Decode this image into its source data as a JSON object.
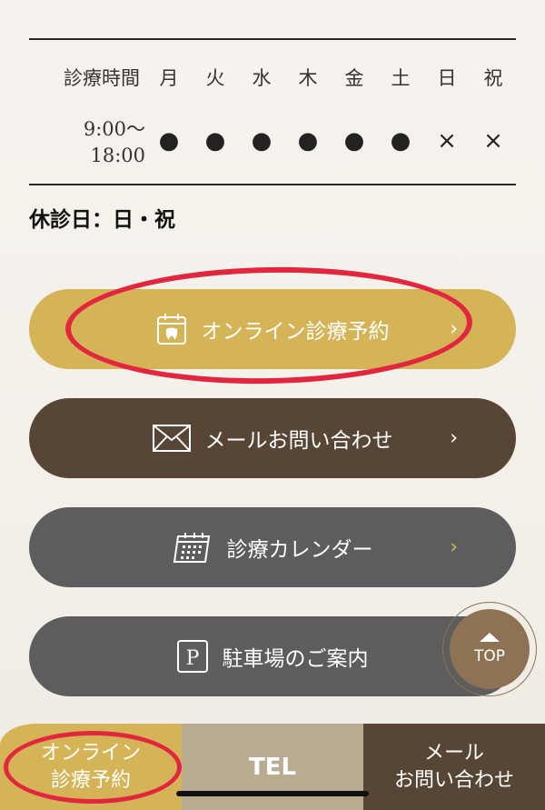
{
  "hours": {
    "header_label": "診療時間",
    "days": [
      "月",
      "火",
      "水",
      "木",
      "金",
      "土",
      "日",
      "祝"
    ],
    "time_line1": "9:00〜",
    "time_line2": "18:00",
    "marks": [
      "●",
      "●",
      "●",
      "●",
      "●",
      "●",
      "×",
      "×"
    ]
  },
  "closed_days": "休診日：日・祝",
  "buttons": {
    "online": "オンライン診療予約",
    "mail": "メールお問い合わせ",
    "calendar": "診療カレンダー",
    "parking": "駐車場のご案内",
    "chevron": "›"
  },
  "top_button": {
    "label": "TOP"
  },
  "bottom_tabs": {
    "online_line1": "オンライン",
    "online_line2": "診療予約",
    "tel": "TEL",
    "mail_line1": "メール",
    "mail_line2": "お問い合わせ"
  },
  "colors": {
    "gold": "#d4b457",
    "brown": "#574536",
    "gray": "#5d5d5d",
    "highlight": "#e3263f"
  }
}
